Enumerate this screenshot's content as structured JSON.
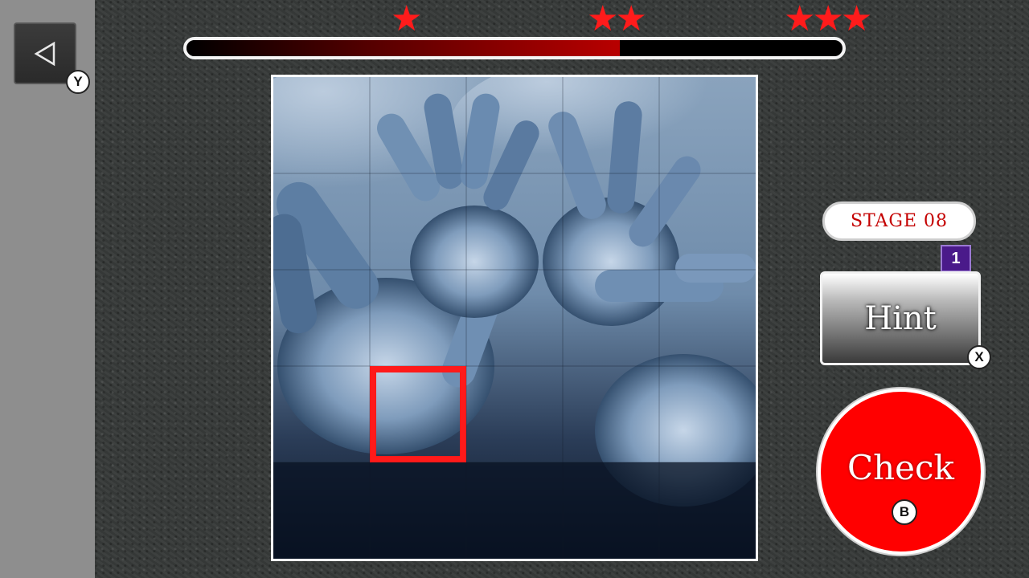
{
  "buttons": {
    "back_badge": "Y",
    "hint_label": "Hint",
    "hint_badge": "X",
    "hint_remaining": "1",
    "check_label": "Check",
    "check_badge": "B"
  },
  "stage": {
    "label": "STAGE  08"
  },
  "progress": {
    "fraction": 0.66
  },
  "star_thresholds": [
    {
      "stars": "★"
    },
    {
      "stars": "★★"
    },
    {
      "stars": "★★★"
    }
  ],
  "puzzle": {
    "grid_rows": 5,
    "grid_cols": 5,
    "selected_tile": {
      "row": 3,
      "col": 1
    },
    "selection_color": "#ff1a1a"
  },
  "colors": {
    "accent_red": "#ff0000",
    "star_red": "#ff1b1b",
    "stage_text": "#c40000",
    "hint_counter": "#4a1a8a"
  }
}
